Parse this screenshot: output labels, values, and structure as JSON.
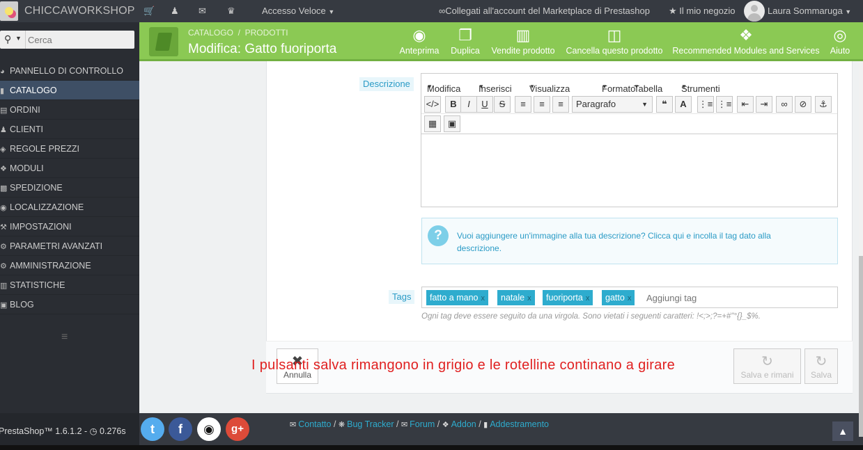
{
  "topbar": {
    "brand": "CHICCAWORKSHOP",
    "icons": [
      "cart-icon",
      "user-icon",
      "envelope-icon",
      "trophy-icon"
    ],
    "quick_access": "Accesso Veloce",
    "marketplace": "Collegati all'account del Marketplace di Prestashop",
    "shop": "Il mio negozio",
    "user": "Laura Sommaruga"
  },
  "sidebar": {
    "search_placeholder": "Cerca",
    "items": [
      {
        "label": "PANNELLO DI CONTROLLO",
        "icon": "dashboard-icon"
      },
      {
        "label": "CATALOGO",
        "icon": "book-icon",
        "active": true
      },
      {
        "label": "ORDINI",
        "icon": "credit-card-icon"
      },
      {
        "label": "CLIENTI",
        "icon": "users-icon"
      },
      {
        "label": "REGOLE PREZZI",
        "icon": "tag-icon"
      },
      {
        "label": "MODULI",
        "icon": "puzzle-icon"
      },
      {
        "label": "SPEDIZIONE",
        "icon": "truck-icon"
      },
      {
        "label": "LOCALIZZAZIONE",
        "icon": "globe-icon"
      },
      {
        "label": "IMPOSTAZIONI",
        "icon": "wrench-icon"
      },
      {
        "label": "PARAMETRI AVANZATI",
        "icon": "cogs-icon"
      },
      {
        "label": "AMMINISTRAZIONE",
        "icon": "gear-icon"
      },
      {
        "label": "STATISTICHE",
        "icon": "bar-chart-icon"
      },
      {
        "label": "BLOG",
        "icon": "blog-icon"
      }
    ],
    "version": "PrestaShop™ 1.6.1.2 - ",
    "load_time": "0.276s"
  },
  "toolbar": {
    "breadcrumb_1": "CATALOGO",
    "breadcrumb_sep": "/",
    "breadcrumb_2": "PRODOTTI",
    "title": "Modifica: Gatto fuoriporta",
    "buttons": [
      {
        "label": "Anteprima",
        "icon": "eye-icon"
      },
      {
        "label": "Duplica",
        "icon": "copy-icon"
      },
      {
        "label": "Vendite prodotto",
        "icon": "bar-chart-icon"
      },
      {
        "label": "Cancella questo prodotto",
        "icon": "trash-icon"
      },
      {
        "label": "Recommended Modules and Services",
        "icon": "puzzle-icon"
      },
      {
        "label": "Aiuto",
        "icon": "lifebuoy-icon"
      }
    ]
  },
  "form": {
    "description_label": "Descrizione",
    "editor_menu": [
      "Modifica",
      "Inserisci",
      "Visualizza",
      "Formato",
      "Tabella",
      "Strumenti"
    ],
    "paragraph_select": "Paragrafo",
    "info_text": "Vuoi aggiungere un'immagine alla tua descrizione? Clicca qui e incolla il tag dato alla descrizione.",
    "tags_label": "Tags",
    "tags": [
      "fatto a mano",
      "natale",
      "fuoriporta",
      "gatto"
    ],
    "tag_placeholder": "Aggiungi tag",
    "tag_hint": "Ogni tag deve essere seguito da una virgola. Sono vietati i seguenti caratteri: !<;>;?=+#\"°{}_$%."
  },
  "footer_buttons": {
    "cancel": "Annulla",
    "save_stay": "Salva e rimani",
    "save": "Salva"
  },
  "annotation": "I pulsanti salva rimangono in grigio e le rotelline continano a girare",
  "footer": {
    "links": [
      "Contatto",
      "Bug Tracker",
      "Forum",
      "Addon",
      "Addestramento"
    ],
    "social": [
      "twitter-icon",
      "facebook-icon",
      "github-icon",
      "google-plus-icon"
    ],
    "colors": {
      "twitter": "#55acee",
      "facebook": "#3b5998",
      "github": "#ffffff",
      "google_plus": "#dd4b39"
    }
  },
  "colors": {
    "accent_green": "#8bc954",
    "link_blue": "#2eacce",
    "annotation_red": "#e02020"
  }
}
